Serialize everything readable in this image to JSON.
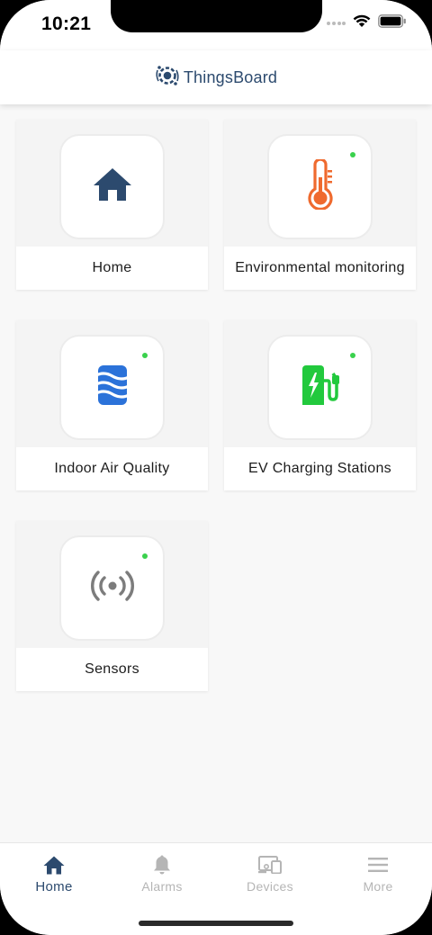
{
  "status_bar": {
    "time": "10:21"
  },
  "header": {
    "brand": "ThingsBoard"
  },
  "tiles": [
    {
      "label": "Home",
      "icon": "home-icon",
      "icon_color": "#2c4a6e",
      "online": false
    },
    {
      "label": "Environmental monitoring",
      "icon": "thermometer-icon",
      "icon_color": "#ef6a2e",
      "online": true
    },
    {
      "label": "Indoor Air Quality",
      "icon": "air-quality-icon",
      "icon_color": "#2b72d9",
      "online": true
    },
    {
      "label": "EV Charging Stations",
      "icon": "ev-charger-icon",
      "icon_color": "#22c93d",
      "online": true
    },
    {
      "label": "Sensors",
      "icon": "sensor-icon",
      "icon_color": "#7c7c7c",
      "online": true
    }
  ],
  "bottom_nav": [
    {
      "label": "Home",
      "icon": "home-icon",
      "active": true
    },
    {
      "label": "Alarms",
      "icon": "bell-icon",
      "active": false
    },
    {
      "label": "Devices",
      "icon": "devices-icon",
      "active": false
    },
    {
      "label": "More",
      "icon": "menu-icon",
      "active": false
    }
  ],
  "colors": {
    "accent": "#2c4a6e",
    "online_dot": "#3ad14d",
    "inactive_nav": "#b5b5b5"
  }
}
